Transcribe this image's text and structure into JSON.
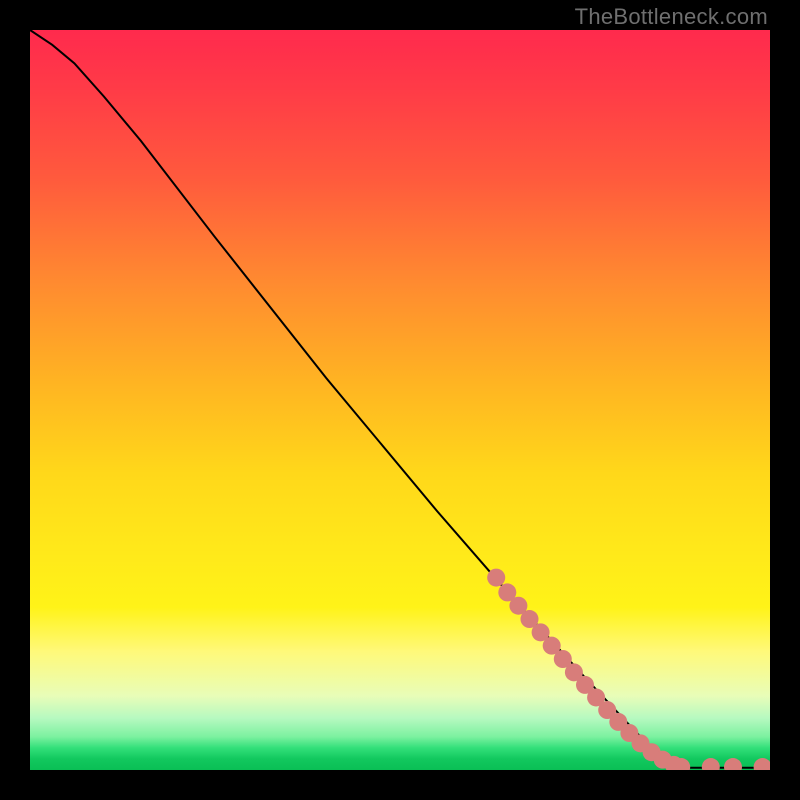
{
  "watermark": {
    "text": "TheBottleneck.com"
  },
  "colors": {
    "curve_stroke": "#000000",
    "marker_fill": "#d87d7a",
    "marker_stroke": "#c06a67"
  },
  "chart_data": {
    "type": "line",
    "title": "",
    "xlabel": "",
    "ylabel": "",
    "xlim": [
      0,
      100
    ],
    "ylim": [
      0,
      100
    ],
    "grid": false,
    "legend": false,
    "curve": [
      {
        "x": 0,
        "y": 100
      },
      {
        "x": 3,
        "y": 98
      },
      {
        "x": 6,
        "y": 95.5
      },
      {
        "x": 10,
        "y": 91
      },
      {
        "x": 15,
        "y": 85
      },
      {
        "x": 25,
        "y": 72
      },
      {
        "x": 40,
        "y": 53
      },
      {
        "x": 55,
        "y": 35
      },
      {
        "x": 65,
        "y": 23.5
      },
      {
        "x": 75,
        "y": 12.5
      },
      {
        "x": 82,
        "y": 5
      },
      {
        "x": 86,
        "y": 1.2
      },
      {
        "x": 88,
        "y": 0.3
      },
      {
        "x": 92,
        "y": 0.3
      },
      {
        "x": 96,
        "y": 0.3
      },
      {
        "x": 100,
        "y": 0.3
      }
    ],
    "markers": [
      {
        "x": 63,
        "y": 26
      },
      {
        "x": 64.5,
        "y": 24
      },
      {
        "x": 66,
        "y": 22.2
      },
      {
        "x": 67.5,
        "y": 20.4
      },
      {
        "x": 69,
        "y": 18.6
      },
      {
        "x": 70.5,
        "y": 16.8
      },
      {
        "x": 72,
        "y": 15
      },
      {
        "x": 73.5,
        "y": 13.2
      },
      {
        "x": 75,
        "y": 11.5
      },
      {
        "x": 76.5,
        "y": 9.8
      },
      {
        "x": 78,
        "y": 8.1
      },
      {
        "x": 79.5,
        "y": 6.5
      },
      {
        "x": 81,
        "y": 5
      },
      {
        "x": 82.5,
        "y": 3.6
      },
      {
        "x": 84,
        "y": 2.4
      },
      {
        "x": 85.5,
        "y": 1.4
      },
      {
        "x": 87,
        "y": 0.7
      },
      {
        "x": 88,
        "y": 0.4
      },
      {
        "x": 92,
        "y": 0.4
      },
      {
        "x": 95,
        "y": 0.4
      },
      {
        "x": 99,
        "y": 0.4
      }
    ]
  }
}
